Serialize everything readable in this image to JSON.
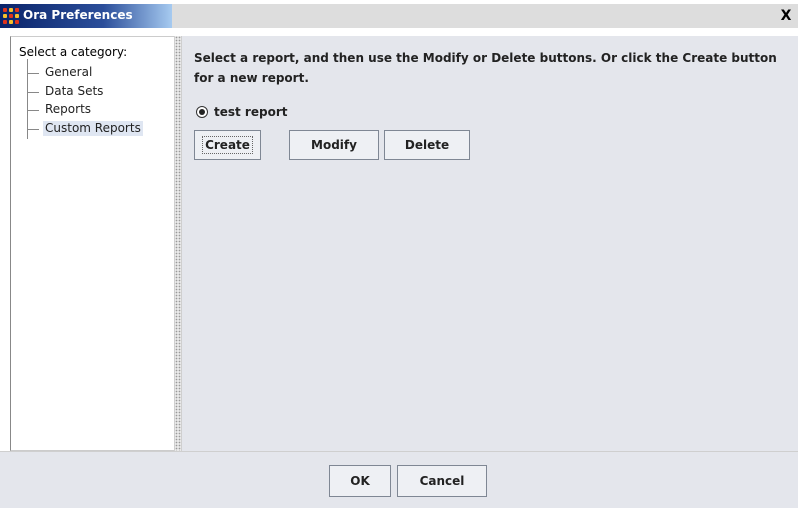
{
  "window": {
    "title": "Ora Preferences",
    "close_label": "X"
  },
  "sidebar": {
    "root_label": "Select a category:",
    "items": [
      {
        "label": "General",
        "selected": false
      },
      {
        "label": "Data Sets",
        "selected": false
      },
      {
        "label": "Reports",
        "selected": false
      },
      {
        "label": "Custom Reports",
        "selected": true
      }
    ]
  },
  "main": {
    "instructions": "Select a report, and then use the Modify or Delete buttons. Or click the Create button for a new report.",
    "reports": [
      {
        "label": "test report",
        "selected": true
      }
    ],
    "buttons": {
      "create": "Create",
      "modify": "Modify",
      "delete": "Delete"
    }
  },
  "footer": {
    "ok": "OK",
    "cancel": "Cancel"
  },
  "colors": {
    "title_bar": "#0a246a",
    "panel_bg": "#e4e6ec",
    "selection": "#dfe6f2"
  }
}
